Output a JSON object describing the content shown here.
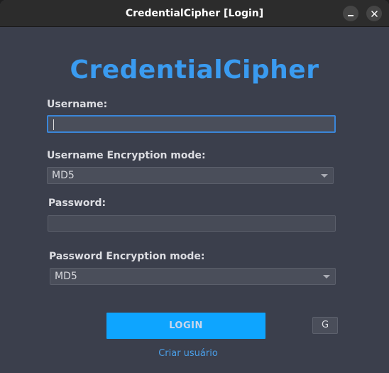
{
  "window": {
    "title": "CredentialCipher [Login]",
    "minimize_icon": "minimize-icon",
    "close_icon": "close-icon"
  },
  "app": {
    "title": "CredentialCipher"
  },
  "form": {
    "username_label": "Username:",
    "username_value": "",
    "username_encryption_label": "Username Encryption mode:",
    "username_encryption_value": "MD5",
    "password_label": "Password:",
    "password_value": "",
    "password_encryption_label": "Password Encryption mode:",
    "password_encryption_value": "MD5"
  },
  "actions": {
    "login_label": "LOGIN",
    "g_label": "G",
    "create_user_label": "Criar usuário"
  },
  "colors": {
    "accent": "#3a9bf0",
    "button": "#0ea5ff",
    "background": "#3b3f4c",
    "titlebar": "#2c2c2c"
  }
}
